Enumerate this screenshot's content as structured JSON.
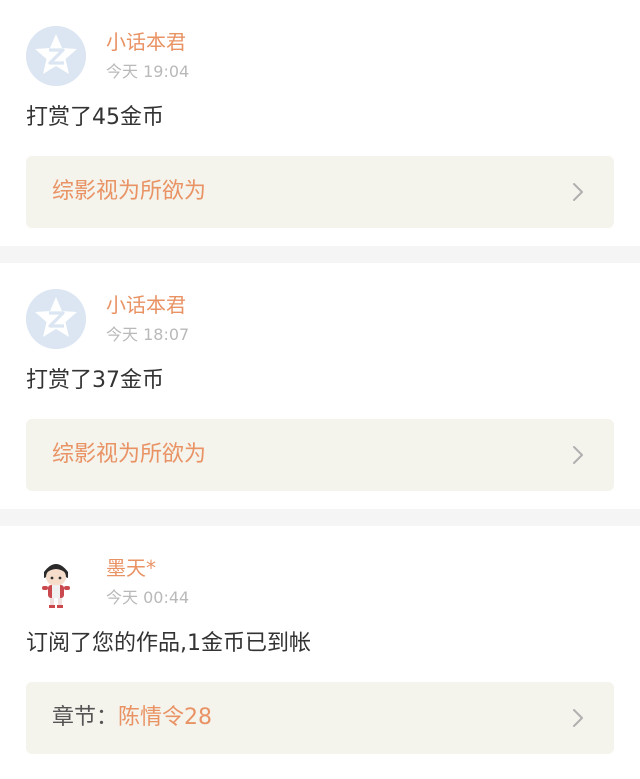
{
  "feed": [
    {
      "user": "小话本君",
      "time": "今天 19:04",
      "avatar_icon": "qq-star-avatar",
      "message": "打赏了45金币",
      "link_prefix": "",
      "link_title": "综影视为所欲为"
    },
    {
      "user": "小话本君",
      "time": "今天 18:07",
      "avatar_icon": "qq-star-avatar",
      "message": "打赏了37金币",
      "link_prefix": "",
      "link_title": "综影视为所欲为"
    },
    {
      "user": "墨天*",
      "time": "今天 00:44",
      "avatar_icon": "chibi-character-avatar",
      "message": "订阅了您的作品,1金币已到帐",
      "link_prefix": "章节：",
      "link_title": "陈情令28"
    }
  ],
  "colors": {
    "accent": "#e99365",
    "time_gray": "#b9b9b9",
    "text": "#333333",
    "link_bg": "#f4f3ec",
    "page_bg": "#f5f5f5",
    "avatar_blue": "#dbe6f2"
  }
}
